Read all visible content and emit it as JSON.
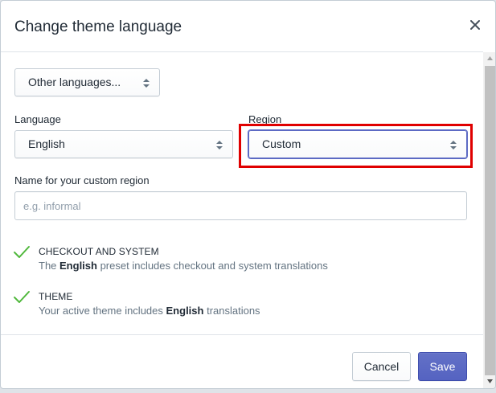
{
  "dialog": {
    "title": "Change theme language"
  },
  "other_languages": {
    "value": "Other languages..."
  },
  "language": {
    "label": "Language",
    "value": "English"
  },
  "region": {
    "label": "Region",
    "value": "Custom"
  },
  "custom_region": {
    "label": "Name for your custom region",
    "placeholder": "e.g. informal"
  },
  "checks": [
    {
      "title": "CHECKOUT AND SYSTEM",
      "desc_before": "The ",
      "desc_bold": "English",
      "desc_after": " preset includes checkout and system translations"
    },
    {
      "title": "THEME",
      "desc_before": "Your active theme includes ",
      "desc_bold": "English",
      "desc_after": " translations"
    }
  ],
  "footer": {
    "cancel_label": "Cancel",
    "save_label": "Save"
  },
  "colors": {
    "primary": "#5c6ac4",
    "check": "#50b83c",
    "highlight": "#e00000"
  },
  "icons": {
    "close": "close-icon",
    "select_arrows": "select-arrows-icon",
    "checkmark": "checkmark-icon"
  }
}
